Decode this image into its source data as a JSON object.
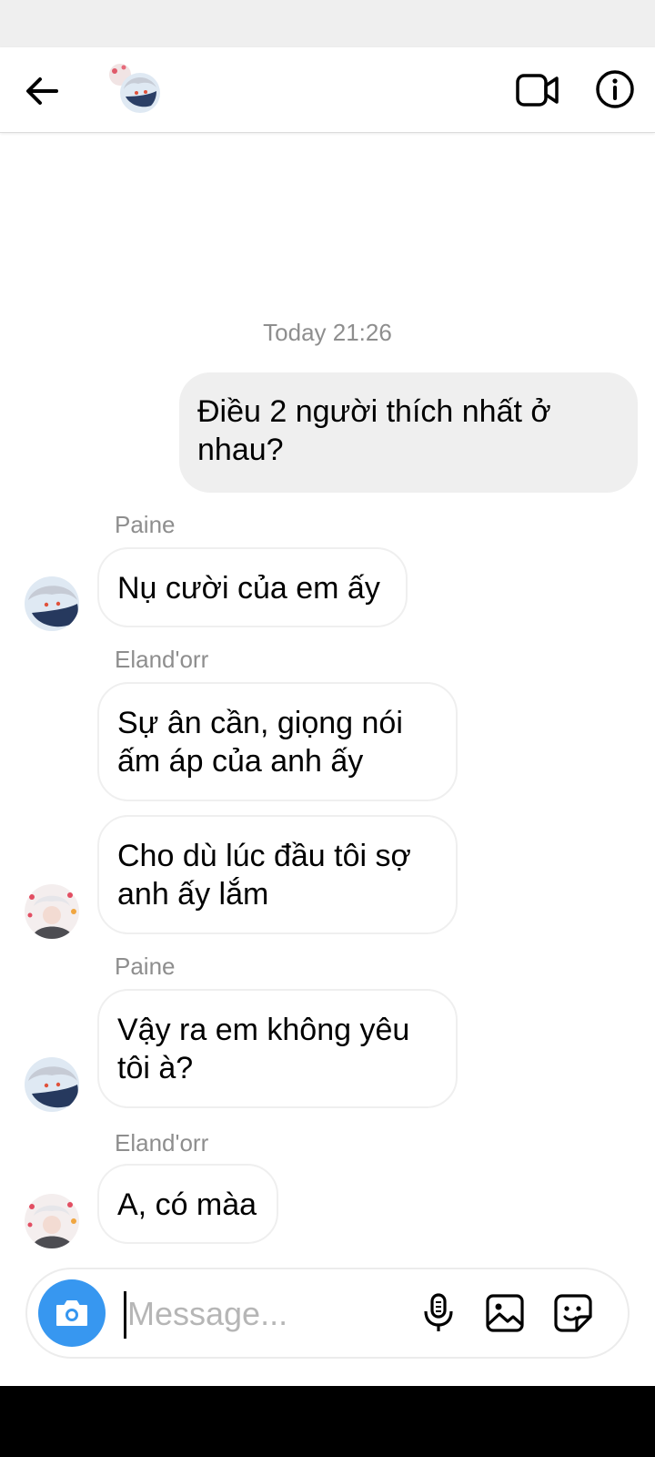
{
  "header": {
    "back_icon": "arrow-left-icon",
    "video_icon": "video-camera-icon",
    "info_icon": "info-circle-icon"
  },
  "conversation": {
    "timestamp": "Today 21:26",
    "messages": [
      {
        "direction": "outgoing",
        "text": "Điều 2 người thích nhất ở nhau?"
      },
      {
        "sender": "Paine",
        "text": "Nụ cười của em ấy"
      },
      {
        "sender": "Eland'orr",
        "text": "Sự ân cần, giọng nói ấm áp của anh ấy"
      },
      {
        "text": "Cho dù lúc đầu tôi sợ anh ấy lắm"
      },
      {
        "sender": "Paine",
        "text": "Vậy ra em không yêu tôi à?"
      },
      {
        "sender": "Eland'orr",
        "text": "A, có màa"
      }
    ]
  },
  "composer": {
    "placeholder": "Message...",
    "camera_icon": "camera-icon",
    "mic_icon": "microphone-icon",
    "gallery_icon": "image-icon",
    "sticker_icon": "sticker-icon"
  },
  "colors": {
    "accent": "#3797f0",
    "outgoing_bubble": "#efefef",
    "muted_text": "#8e8e8e"
  }
}
